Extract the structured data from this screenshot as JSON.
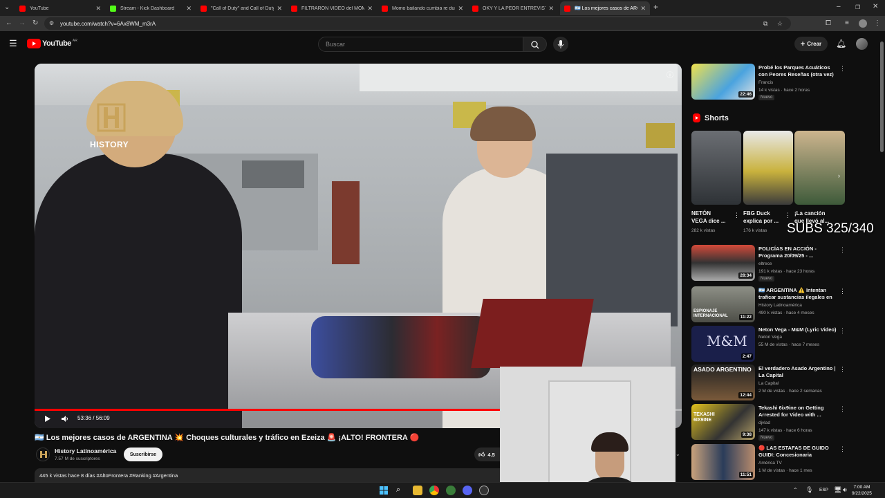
{
  "browser": {
    "tabs": [
      {
        "title": "YouTube",
        "active": false
      },
      {
        "title": "Stream - Kick Dashboard",
        "active": false
      },
      {
        "title": "\"Call of Duty\" and Call of Duty",
        "active": false
      },
      {
        "title": "FILTRARON VIDEO del MOMO",
        "active": false
      },
      {
        "title": "Momo bailando cumbia re duro",
        "active": false
      },
      {
        "title": "OKY Y LA PEOR ENTREVISTA DE",
        "active": false
      },
      {
        "title": "🇦🇷 Los mejores casos de ARGEN",
        "active": true
      }
    ],
    "url": "youtube.com/watch?v=6Ax8WM_m3rA"
  },
  "masthead": {
    "logo_text": "YouTube",
    "country_code": "AR",
    "search_placeholder": "Buscar",
    "create_label": "Crear"
  },
  "player": {
    "channel_watermark": "HISTORY",
    "time": "53:36 / 56:09",
    "progress": 0.955
  },
  "video": {
    "title": "🇦🇷 Los mejores casos de ARGENTINA 💥 Choques culturales y tráfico en Ezeiza 🚨 ¡ALTO! FRONTERA 🔴",
    "channel": "History Latinoamérica",
    "subscribers": "7.57 M de suscriptores",
    "subscribe_label": "Suscribirse",
    "likes": "4.5",
    "description_line": "445 k vistas  hace 8 días  #AltoFrontera #Ranking #Argentina"
  },
  "sidebar": {
    "top_video": {
      "title": "Probé los Parques Acuáticos con Peores Reseñas (otra vez)",
      "channel": "Francis",
      "meta": "14 k vistas · hace 2 horas",
      "badge": "Nuevo",
      "duration": "22:46"
    },
    "shorts_heading": "Shorts",
    "shorts": [
      {
        "title": "NETÓN\nVEGA dice ...",
        "views": "282 k vistas"
      },
      {
        "title": "FBG Duck\nexplica por ...",
        "views": "176 k vistas"
      },
      {
        "title": "¡La canción\nque llevó al...",
        "views": ""
      }
    ],
    "videos": [
      {
        "title": "POLICÍAS EN ACCIÓN - Programa 20/09/25 - ...",
        "channel": "eltrece",
        "meta": "191 k vistas · hace 23 horas",
        "badge": "Nuevo",
        "duration": "28:34"
      },
      {
        "title": "🇦🇷 ARGENTINA ⚠️ Intentan traficar sustancias ilegales en ...",
        "channel": "History Latinoamérica",
        "meta": "490 k vistas · hace 4 meses",
        "badge": "",
        "duration": "11:22"
      },
      {
        "title": "Neton Vega - M&M (Lyric Video)",
        "channel": "Neton Vega",
        "meta": "55 M de vistas · hace 7 meses",
        "badge": "",
        "duration": "2:47"
      },
      {
        "title": "El verdadero Asado Argentino | La Capital",
        "channel": "La Capital",
        "meta": "2 M de vistas · hace 2 semanas",
        "badge": "",
        "duration": "12:44"
      },
      {
        "title": "Tekashi 6ix9ine on Getting Arrested for Video with ...",
        "channel": "djvlad",
        "meta": "147 k vistas · hace 6 horas",
        "badge": "Nuevo",
        "duration": "9:38"
      },
      {
        "title": "🔴 LAS ESTAFAS DE GUIDO GUIDI: Concesionaria esconde...",
        "channel": "América TV",
        "meta": "1 M de vistas · hace 1 mes",
        "badge": "",
        "duration": "11:51"
      }
    ],
    "thumb_texts": [
      "ESPIONAJE INTERNACIONAL",
      "M&M",
      "ASADO ARGENTINO",
      "TEKASHI 6IX9INE"
    ]
  },
  "overlay": {
    "subs_counter": "SUBS 325/340"
  },
  "taskbar": {
    "language": "ESP",
    "time": "7:00 AM",
    "date": "9/22/2025"
  },
  "colors": {
    "background": "#0f0f0f",
    "accent_red": "#ff0000",
    "surface": "#272727"
  }
}
